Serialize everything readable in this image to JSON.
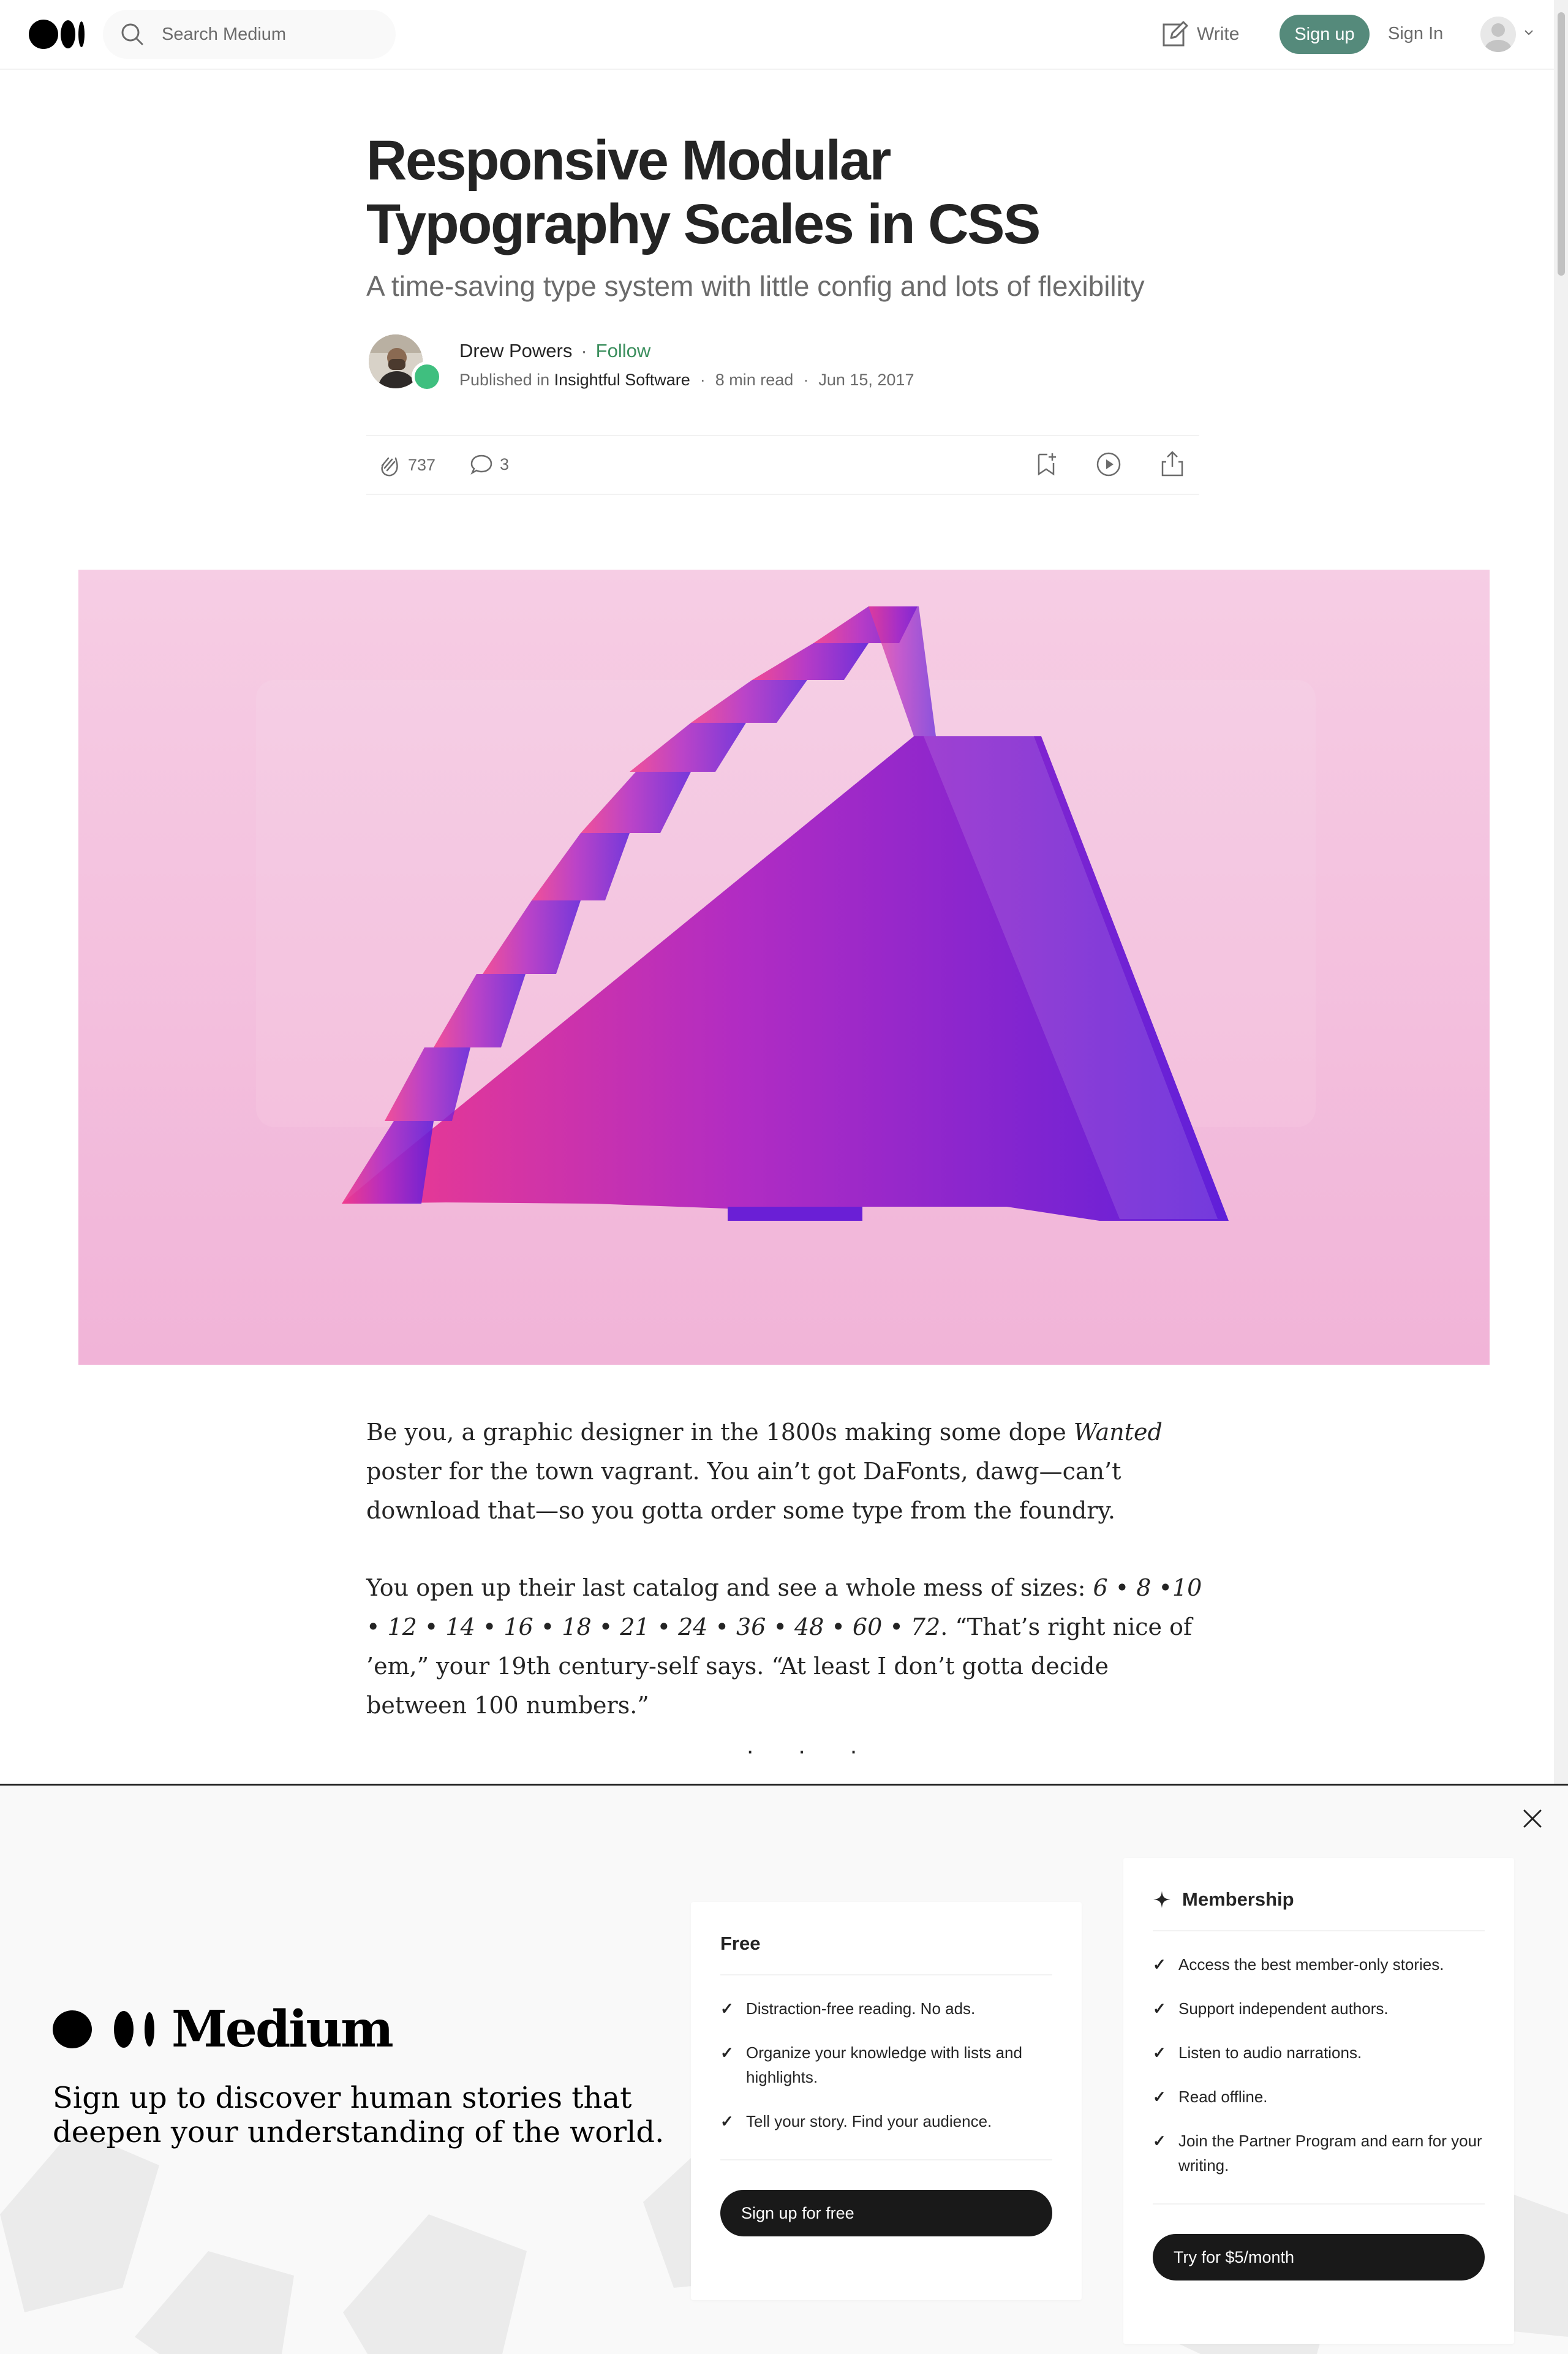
{
  "header": {
    "search_placeholder": "Search Medium",
    "write_label": "Write",
    "signup_label": "Sign up",
    "signin_label": "Sign In"
  },
  "article": {
    "title": "Responsive Modular Typography Scales in CSS",
    "subtitle": "A time-saving type system with little config and lots of flexibility",
    "author": "Drew Powers",
    "follow_label": "Follow",
    "published_in_label": "Published in",
    "publication": "Insightful Software",
    "read_time": "8 min read",
    "date": "Jun 15, 2017",
    "claps": "737",
    "responses": "3",
    "para1_a": "Be you, a graphic designer in the 1800s making some dope ",
    "para1_em": "Wanted",
    "para1_b": " poster for the town vagrant. You ain’t got DaFonts, dawg—can’t download that—so you gotta order some type from the foundry.",
    "para2_a": "You open up their last catalog and see a whole mess of sizes: ",
    "para2_em": "6 • 8 •10 • 12 • 14 • 16 • 18 • 21 • 24 • 36 • 48 • 60 • 72",
    "para2_b": ". “That’s right nice of ’em,” your 19th century-self says. “At least I don’t gotta decide between 100 numbers.”",
    "separator": "· · ·"
  },
  "overlay": {
    "brand": "Medium",
    "tagline": "Sign up to discover human stories that deepen your understanding of the world.",
    "free": {
      "title": "Free",
      "features": [
        "Distraction-free reading. No ads.",
        "Organize your knowledge with lists and highlights.",
        "Tell your story. Find your audience."
      ],
      "cta": "Sign up for free"
    },
    "membership": {
      "title": "Membership",
      "features": [
        "Access the best member-only stories.",
        "Support independent authors.",
        "Listen to audio narrations.",
        "Read offline.",
        "Join the Partner Program and earn for your writing."
      ],
      "cta": "Try for $5/month"
    }
  },
  "colors": {
    "follow_green": "#3c8f5e",
    "signup_button": "#558a7b",
    "hero_bg": "#f3c2df",
    "dark_button": "#191919"
  }
}
